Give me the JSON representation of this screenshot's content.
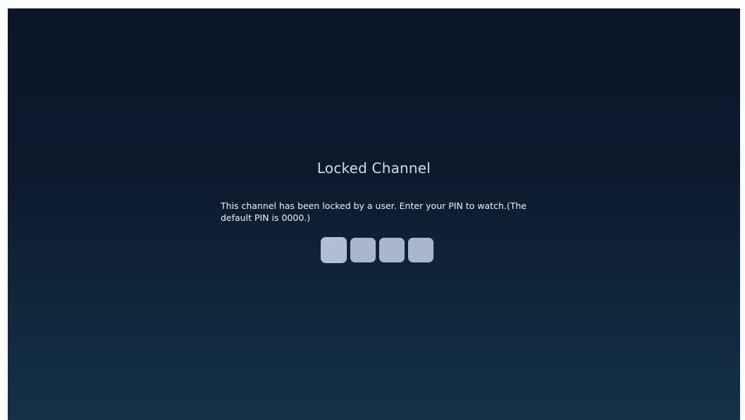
{
  "dialog": {
    "title": "Locked Channel",
    "message": "This channel has been locked by a user. Enter your PIN to watch.(The default PIN is 0000.)"
  },
  "pin": {
    "digits": [
      "",
      "",
      "",
      ""
    ],
    "focused_index": 0,
    "box_color": "#aab6cc"
  },
  "theme": {
    "background_top": "#0b1628",
    "background_bottom": "#143148"
  }
}
